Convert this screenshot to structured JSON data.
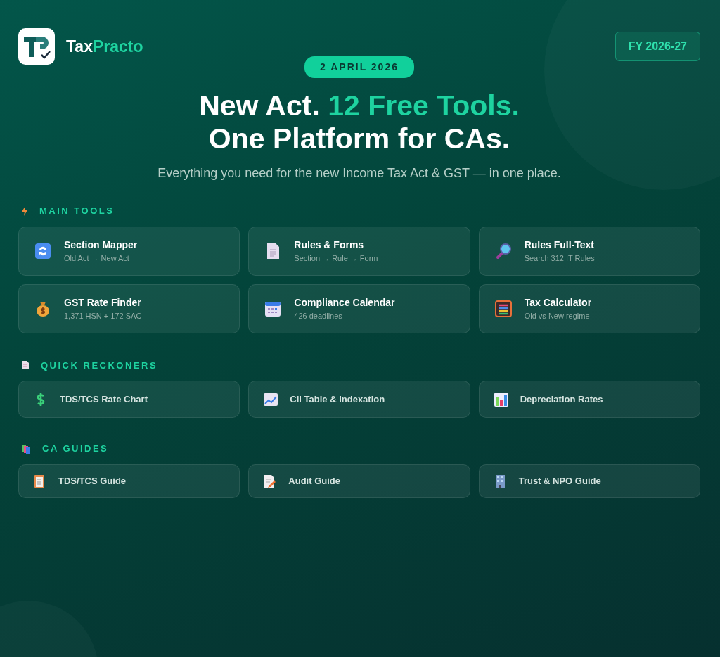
{
  "brand": {
    "parts": [
      {
        "text": "Tax",
        "accent": false
      },
      {
        "text": "Practo",
        "accent": true
      }
    ]
  },
  "fy_badge": "FY 2026-27",
  "date_pill": "2 APRIL 2026",
  "headline": [
    [
      {
        "text": "New Act. ",
        "accent": false
      },
      {
        "text": "12 Free Tools.",
        "accent": true
      }
    ],
    [
      {
        "text": "One Platform for CAs.",
        "accent": false
      }
    ]
  ],
  "subtitle": "Everything you need for the new Income Tax Act & GST — in one place.",
  "sections": [
    {
      "title": "MAIN TOOLS",
      "kind": "tools",
      "items": [
        {
          "title": "Section Mapper",
          "subtitle": "Old Act → New Act"
        },
        {
          "title": "Rules & Forms",
          "subtitle": "Section → Rule → Form"
        },
        {
          "title": "Rules Full-Text",
          "subtitle": "Search 312 IT Rules"
        },
        {
          "title": "GST Rate Finder",
          "subtitle": "1,371 HSN + 172 SAC"
        },
        {
          "title": "Compliance Calendar",
          "subtitle": "426 deadlines"
        },
        {
          "title": "Tax Calculator",
          "subtitle": "Old vs New regime"
        }
      ]
    },
    {
      "title": "QUICK RECKONERS",
      "kind": "reckoners",
      "items": [
        {
          "title": "TDS/TCS Rate Chart"
        },
        {
          "title": "CII Table & Indexation"
        },
        {
          "title": "Depreciation Rates"
        }
      ]
    },
    {
      "title": "CA GUIDES",
      "kind": "guides",
      "items": [
        {
          "title": "TDS/TCS Guide"
        },
        {
          "title": "Audit Guide"
        },
        {
          "title": "Trust & NPO Guide"
        }
      ]
    }
  ]
}
